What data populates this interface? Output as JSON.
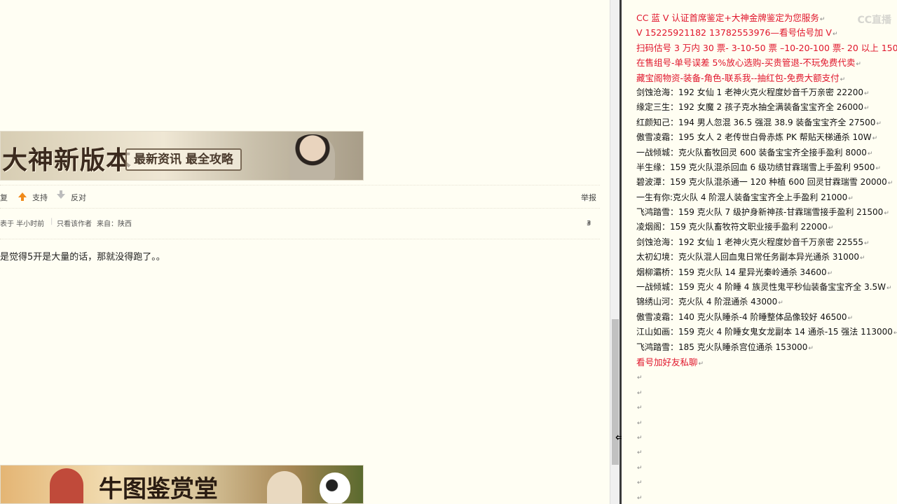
{
  "forum": {
    "banner_top": {
      "headline": "大神新版本",
      "slogan": "最新资讯 最全攻略"
    },
    "banner_bottom": {
      "headline": "牛图鉴赏堂"
    },
    "actions": {
      "reply_partial": "复",
      "support_label": "支持",
      "oppose_label": "反对",
      "report_label": "举报"
    },
    "meta": {
      "posted_time": "表于 半小时前",
      "author_only": "只看该作者",
      "source": "来自：陕西",
      "floor": "3",
      "floor_suffix": "#"
    },
    "post_text": "是觉得5开是大量的话，那就没得跑了。。"
  },
  "doc": {
    "pilcrow": "↵",
    "watermark": "CC直播",
    "lines": [
      {
        "text": "CC 蓝 V 认证首席鉴定+大神金牌鉴定为您服务",
        "red": true
      },
      {
        "text": "V 15225921182      13782553976—看号估号加 V",
        "red": true
      },
      {
        "text": "扫码估号 3 万内 30 票- 3-10-50 票 –10-20-100 票- 20 以上 150",
        "red": true
      },
      {
        "text": "在售组号-单号误差 5%放心选购-买贵管退-不玩免费代卖",
        "red": true
      },
      {
        "text": "藏宝阁物资-装备-角色-联系我--抽红包-免费大额支付",
        "red": true
      },
      {
        "text": "剑蚀沧海：192 女仙 1 老神火克火程度妙音千万亲密 22200",
        "red": false
      },
      {
        "text": "缘定三生：192 女魔 2 孩子克水抽全满装备宝宝齐全 26000",
        "red": false
      },
      {
        "text": "红颜知己：194 男人忽混 36.5 强混 38.9 装备宝宝齐全 27500",
        "red": false
      },
      {
        "text": "傲雪凌霜：195 女人 2 老传世白骨赤炼 PK 帮贴天梯通杀 10W",
        "red": false
      },
      {
        "text": "一战倾城：克火队畜牧回灵 600 装备宝宝齐全接手盈利 8000",
        "red": false
      },
      {
        "text": "半生缘：159 克火队混杀回血 6 级功绩甘霖瑞雪上手盈利 9500",
        "red": false
      },
      {
        "text": "碧波潭：159 克火队混杀通一 120 种植 600 回灵甘霖瑞雪 20000",
        "red": false
      },
      {
        "text": "一生有你:克火队 4 阶混人装备宝宝齐全上手盈利 21000",
        "red": false
      },
      {
        "text": "飞鸿踏雪：159 克火队 7 级护身新神孩-甘霖瑞雪接手盈利 21500",
        "red": false
      },
      {
        "text": "凌烟阁：159 克火队畜牧符文职业接手盈利 22000",
        "red": false
      },
      {
        "text": "剑蚀沧海：192 女仙 1 老神火克火程度妙音千万亲密 22555",
        "red": false
      },
      {
        "text": "太初幻境：克火队混人回血鬼日常任务副本异光通杀 31000",
        "red": false
      },
      {
        "text": "烟柳灞桥：159 克火队 14 星异光秦岭通杀 34600",
        "red": false
      },
      {
        "text": "一战倾城：159 克火 4 阶睡 4 族灵性鬼平秒仙装备宝宝齐全 3.5W",
        "red": false
      },
      {
        "text": "锦绣山河：克火队 4 阶混通杀 43000",
        "red": false
      },
      {
        "text": "傲雪凌霜：140 克火队睡杀-4 阶睡整体品像较好 46500",
        "red": false
      },
      {
        "text": "江山如画：159 克火 4 阶睡女鬼女龙副本 14 通杀-15 强法 113000",
        "red": false
      },
      {
        "text": "飞鸿踏雪：185 克火队睡杀宫位通杀 153000",
        "red": false
      },
      {
        "text": "看号加好友私聊",
        "red": true
      },
      {
        "text": "",
        "red": false
      },
      {
        "text": "",
        "red": false
      },
      {
        "text": "",
        "red": false
      },
      {
        "text": "",
        "red": false
      },
      {
        "text": "",
        "red": false
      },
      {
        "text": "",
        "red": false
      },
      {
        "text": "",
        "red": false
      },
      {
        "text": "",
        "red": false
      },
      {
        "text": "",
        "red": false
      }
    ]
  }
}
